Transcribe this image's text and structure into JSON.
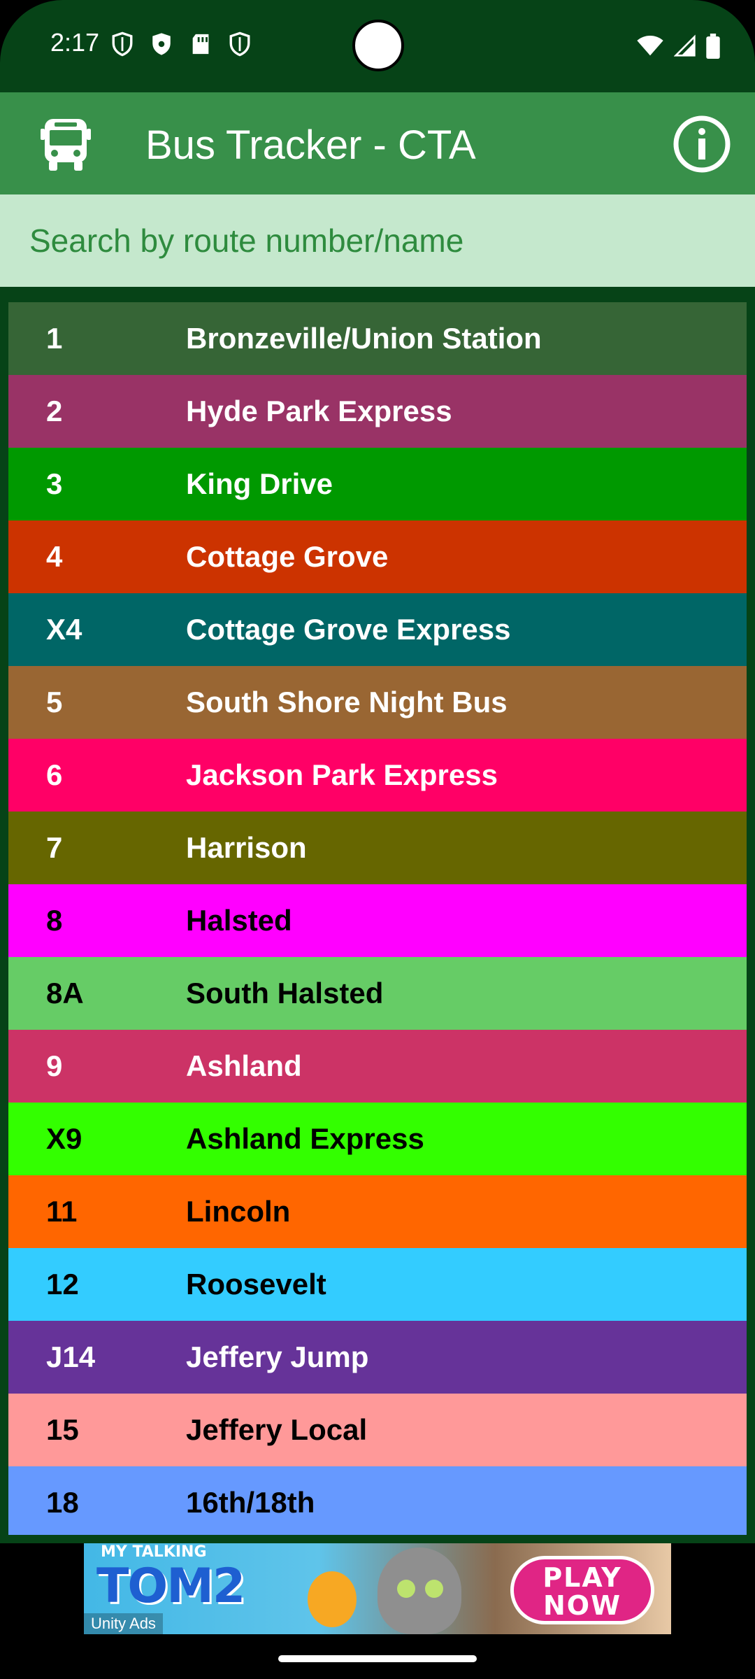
{
  "status_bar": {
    "time": "2:17"
  },
  "app_bar": {
    "title": "Bus Tracker - CTA"
  },
  "search": {
    "placeholder": "Search by route number/name",
    "value": ""
  },
  "routes": [
    {
      "number": "1",
      "name": "Bronzeville/Union Station",
      "bg": "#366536",
      "fg": "#ffffff"
    },
    {
      "number": "2",
      "name": "Hyde Park Express",
      "bg": "#993366",
      "fg": "#ffffff"
    },
    {
      "number": "3",
      "name": "King Drive",
      "bg": "#009900",
      "fg": "#ffffff"
    },
    {
      "number": "4",
      "name": "Cottage Grove",
      "bg": "#cc3300",
      "fg": "#ffffff"
    },
    {
      "number": "X4",
      "name": "Cottage Grove Express",
      "bg": "#006666",
      "fg": "#ffffff"
    },
    {
      "number": "5",
      "name": "South Shore Night Bus",
      "bg": "#996633",
      "fg": "#ffffff"
    },
    {
      "number": "6",
      "name": "Jackson Park Express",
      "bg": "#ff0066",
      "fg": "#ffffff"
    },
    {
      "number": "7",
      "name": "Harrison",
      "bg": "#666600",
      "fg": "#ffffff"
    },
    {
      "number": "8",
      "name": "Halsted",
      "bg": "#ff00ff",
      "fg": "#000000"
    },
    {
      "number": "8A",
      "name": "South Halsted",
      "bg": "#66cc66",
      "fg": "#000000"
    },
    {
      "number": "9",
      "name": "Ashland",
      "bg": "#cc3366",
      "fg": "#ffffff"
    },
    {
      "number": "X9",
      "name": "Ashland Express",
      "bg": "#33ff00",
      "fg": "#000000"
    },
    {
      "number": "11",
      "name": "Lincoln",
      "bg": "#ff6600",
      "fg": "#000000"
    },
    {
      "number": "12",
      "name": "Roosevelt",
      "bg": "#33ccff",
      "fg": "#000000"
    },
    {
      "number": "J14",
      "name": "Jeffery Jump",
      "bg": "#663399",
      "fg": "#ffffff"
    },
    {
      "number": "15",
      "name": "Jeffery Local",
      "bg": "#ff9999",
      "fg": "#000000"
    },
    {
      "number": "18",
      "name": "16th/18th",
      "bg": "#6699ff",
      "fg": "#000000"
    }
  ],
  "ad": {
    "brand_small": "MY TALKING",
    "brand_large": "TOM2",
    "cta_line1": "PLAY",
    "cta_line2": "NOW",
    "network": "Unity Ads"
  },
  "icons": {
    "bus": "bus-icon",
    "info": "info-icon"
  }
}
